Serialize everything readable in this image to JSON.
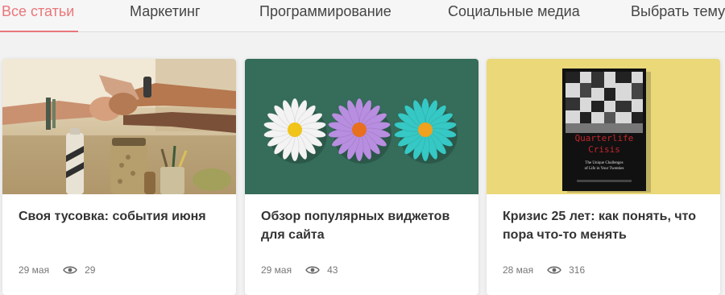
{
  "tabs": [
    {
      "label": "Все статьи",
      "active": true
    },
    {
      "label": "Маркетинг",
      "active": false
    },
    {
      "label": "Программирование",
      "active": false
    },
    {
      "label": "Социальные медиа",
      "active": false
    },
    {
      "label": "Выбрать тему",
      "active": false
    }
  ],
  "accent_color": "#e9767a",
  "cards": [
    {
      "title": "Своя тусовка: события июня",
      "date": "29 мая",
      "views": "29",
      "image": "meeting-hands-photo"
    },
    {
      "title": "Обзор популярных виджетов для сайта",
      "date": "29 мая",
      "views": "43",
      "image": "daisy-flowers-photo"
    },
    {
      "title": "Кризис 25 лет: как понять, что пора что-то менять",
      "date": "28 мая",
      "views": "316",
      "image": "quarterlife-crisis-book-photo"
    }
  ],
  "book": {
    "title_line1": "Quarterlife",
    "title_line2": "Crisis",
    "subtitle_line1": "The Unique Challenges",
    "subtitle_line2": "of Life in Your Twenties"
  }
}
